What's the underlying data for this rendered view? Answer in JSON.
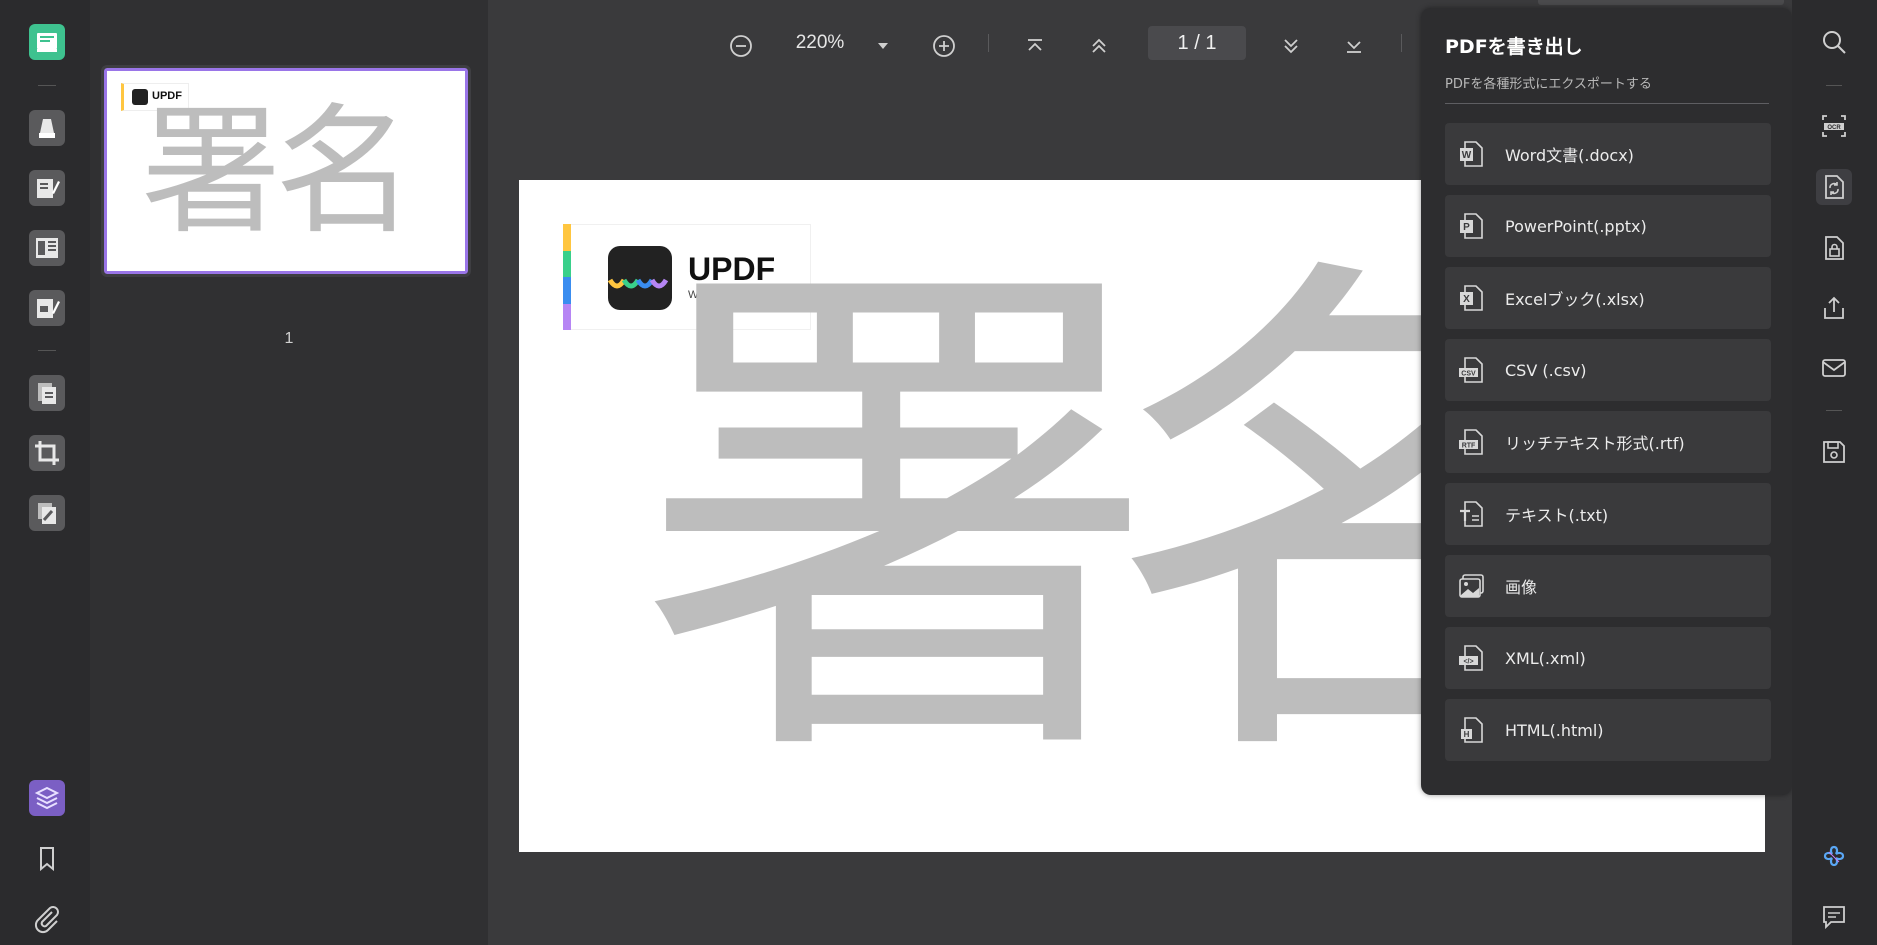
{
  "toolbar": {
    "zoom_value": "220%",
    "page_indicator": "1 / 1"
  },
  "thumbnails": {
    "page_number": "1"
  },
  "document": {
    "main_text": "署名",
    "logo_name": "UPDF",
    "logo_url": "WWW.UPDF.COM"
  },
  "export_panel": {
    "title": "PDFを書き出し",
    "subtitle": "PDFを各種形式にエクスポートする",
    "items": [
      {
        "label": "Word文書(.docx)",
        "icon": "word-icon"
      },
      {
        "label": "PowerPoint(.pptx)",
        "icon": "powerpoint-icon"
      },
      {
        "label": "Excelブック(.xlsx)",
        "icon": "excel-icon"
      },
      {
        "label": "CSV (.csv)",
        "icon": "csv-icon"
      },
      {
        "label": "リッチテキスト形式(.rtf)",
        "icon": "rtf-icon"
      },
      {
        "label": "テキスト(.txt)",
        "icon": "text-icon"
      },
      {
        "label": "画像",
        "icon": "image-icon"
      },
      {
        "label": "XML(.xml)",
        "icon": "xml-icon"
      },
      {
        "label": "HTML(.html)",
        "icon": "html-icon"
      }
    ]
  },
  "colors": {
    "accent_purple": "#9a75e8",
    "reader_green": "#3ec28f",
    "logo_stripe": [
      "#ffc640",
      "#39d08b",
      "#3a8df0",
      "#b685f4"
    ]
  }
}
